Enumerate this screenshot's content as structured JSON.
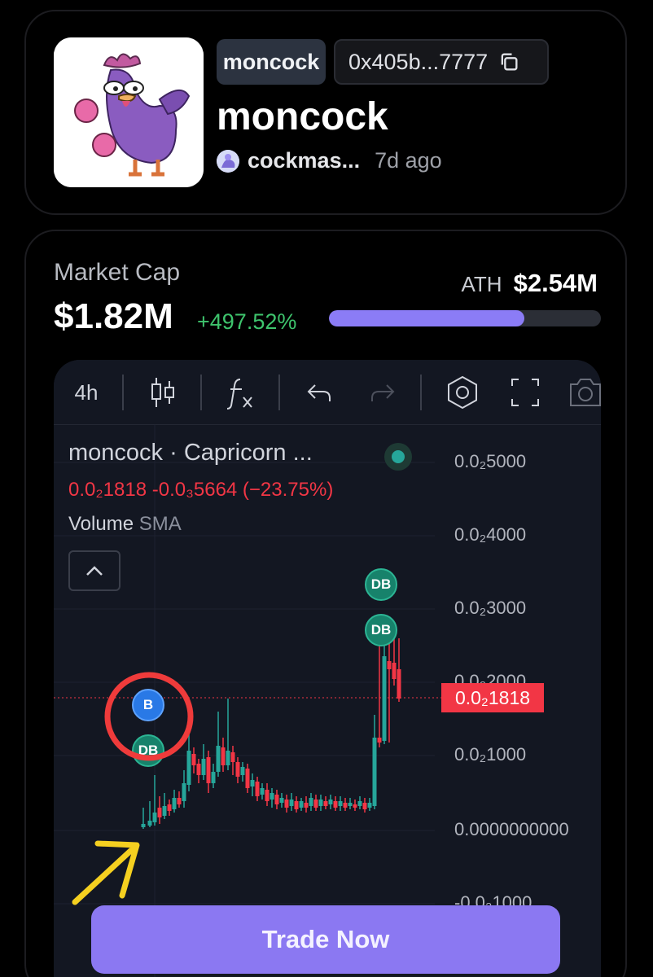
{
  "token": {
    "ticker": "moncock",
    "address": "0x405b...7777",
    "name": "moncock",
    "creator": "cockmas...",
    "age": "7d ago"
  },
  "market": {
    "label": "Market Cap",
    "value": "$1.82M",
    "change": "+497.52%",
    "ath_label": "ATH",
    "ath_value": "$2.54M",
    "ath_progress_fraction": 0.72,
    "accent_color": "#8b7cf6",
    "change_color": "#3ec46d"
  },
  "chart": {
    "toolbar": {
      "interval": "4h",
      "icons": [
        "candles-icon",
        "indicators-icon",
        "undo-icon",
        "redo-icon",
        "settings-hexagon-icon",
        "fullscreen-icon",
        "camera-icon"
      ]
    },
    "legend": {
      "title": "moncock · Capricorn ...",
      "ohlc": "0.0₂1818 -0.0₃5664 (−23.75%)",
      "volume_label": "Volume",
      "volume_indicator": "SMA"
    },
    "price_axis": [
      "0.0₂5000",
      "0.0₂4000",
      "0.0₂3000",
      "0.0₂2000",
      "0.0₂1000",
      "0.0000000000",
      "-0.0₂1000"
    ],
    "current_price": "0.0₂1818",
    "markers": [
      "DB",
      "DB",
      "DB",
      "B"
    ],
    "up_color": "#26a69a",
    "down_color": "#f23645"
  },
  "chart_data": {
    "type": "candlestick",
    "y_axis_ticks": [
      0.0005,
      0.0004,
      0.0003,
      0.0002,
      0.0001,
      0,
      -0.0001
    ],
    "last_price": 0.001818,
    "change_percent": -23.75
  },
  "actions": {
    "trade_label": "Trade Now"
  }
}
